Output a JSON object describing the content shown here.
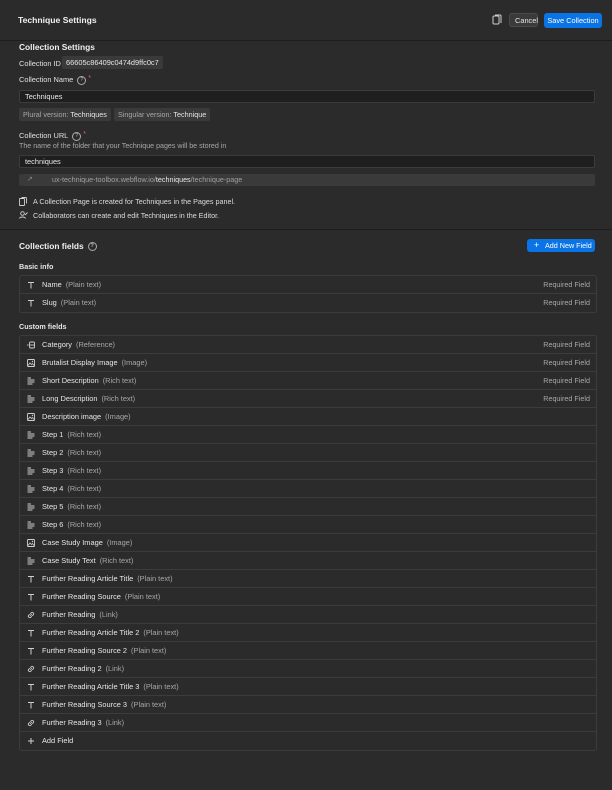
{
  "header": {
    "title": "Technique Settings",
    "cancel_label": "Cancel",
    "save_label": "Save Collection"
  },
  "settings": {
    "heading": "Collection Settings",
    "id_label": "Collection ID",
    "id_value": "66605c86409c0474d9ffc0c7",
    "name_label": "Collection Name",
    "name_value": "Techniques",
    "plural_label": "Plural version:",
    "plural_value": "Techniques",
    "singular_label": "Singular version:",
    "singular_value": "Technique",
    "url_label": "Collection URL",
    "url_desc": "The name of the folder that your Technique pages will be stored in",
    "url_value": "techniques",
    "url_preview_prefix": "ux-technique-toolbox.webflow.io/",
    "url_preview_bold": "techniques",
    "url_preview_suffix": "/technique-page",
    "note_pages": "A Collection Page is created for Techniques in the Pages panel.",
    "note_editors": "Collaborators can create and edit Techniques in the Editor."
  },
  "fields": {
    "heading": "Collection fields",
    "add_new_label": "Add New Field",
    "basic_label": "Basic info",
    "custom_label": "Custom fields",
    "required_text": "Required Field",
    "add_field_label": "Add Field",
    "basic": [
      {
        "icon": "text-icon",
        "name": "Name",
        "type": "(Plain text)",
        "required": true
      },
      {
        "icon": "text-icon",
        "name": "Slug",
        "type": "(Plain text)",
        "required": true
      }
    ],
    "custom": [
      {
        "icon": "reference-icon",
        "name": "Category",
        "type": "(Reference)",
        "required": true
      },
      {
        "icon": "image-icon",
        "name": "Brutalist Display Image",
        "type": "(Image)",
        "required": true
      },
      {
        "icon": "richtext-icon",
        "name": "Short Description",
        "type": "(Rich text)",
        "required": true
      },
      {
        "icon": "richtext-icon",
        "name": "Long Description",
        "type": "(Rich text)",
        "required": true
      },
      {
        "icon": "image-icon",
        "name": "Description image",
        "type": "(Image)",
        "required": false
      },
      {
        "icon": "richtext-icon",
        "name": "Step 1",
        "type": "(Rich text)",
        "required": false
      },
      {
        "icon": "richtext-icon",
        "name": "Step 2",
        "type": "(Rich text)",
        "required": false
      },
      {
        "icon": "richtext-icon",
        "name": "Step 3",
        "type": "(Rich text)",
        "required": false
      },
      {
        "icon": "richtext-icon",
        "name": "Step 4",
        "type": "(Rich text)",
        "required": false
      },
      {
        "icon": "richtext-icon",
        "name": "Step 5",
        "type": "(Rich text)",
        "required": false
      },
      {
        "icon": "richtext-icon",
        "name": "Step 6",
        "type": "(Rich text)",
        "required": false
      },
      {
        "icon": "image-icon",
        "name": "Case Study Image",
        "type": "(Image)",
        "required": false
      },
      {
        "icon": "richtext-icon",
        "name": "Case Study Text",
        "type": "(Rich text)",
        "required": false
      },
      {
        "icon": "text-icon",
        "name": "Further Reading Article Title",
        "type": "(Plain text)",
        "required": false
      },
      {
        "icon": "text-icon",
        "name": "Further Reading Source",
        "type": "(Plain text)",
        "required": false
      },
      {
        "icon": "link-icon",
        "name": "Further Reading",
        "type": "(Link)",
        "required": false
      },
      {
        "icon": "text-icon",
        "name": "Further Reading Article Title 2",
        "type": "(Plain text)",
        "required": false
      },
      {
        "icon": "text-icon",
        "name": "Further Reading Source 2",
        "type": "(Plain text)",
        "required": false
      },
      {
        "icon": "link-icon",
        "name": "Further Reading 2",
        "type": "(Link)",
        "required": false
      },
      {
        "icon": "text-icon",
        "name": "Further Reading Article Title 3",
        "type": "(Plain text)",
        "required": false
      },
      {
        "icon": "text-icon",
        "name": "Further Reading Source 3",
        "type": "(Plain text)",
        "required": false
      },
      {
        "icon": "link-icon",
        "name": "Further Reading 3",
        "type": "(Link)",
        "required": false
      }
    ]
  },
  "colors": {
    "background": "#2b2b2b",
    "accent": "#0a73e6",
    "required_star": "#ff5a5a"
  }
}
